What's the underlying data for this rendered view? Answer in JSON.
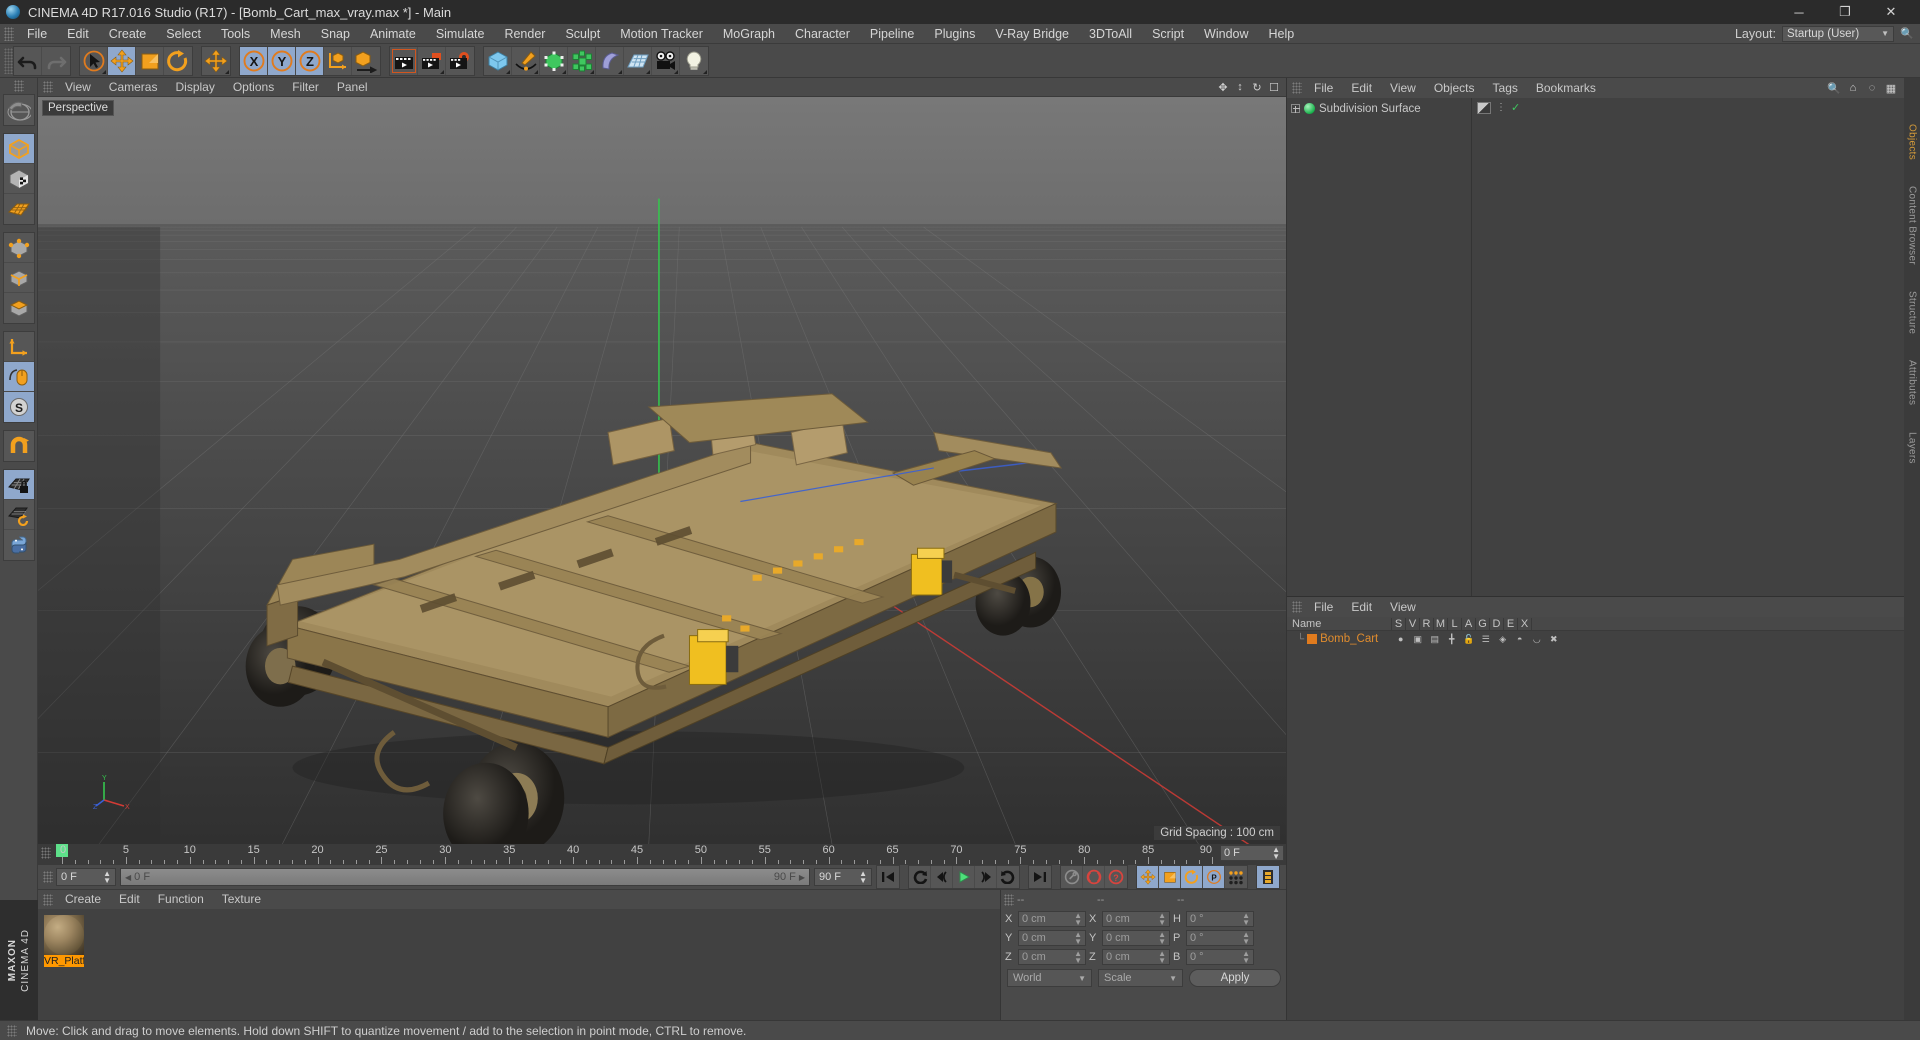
{
  "window": {
    "title": "CINEMA 4D R17.016 Studio (R17) - [Bomb_Cart_max_vray.max *] - Main",
    "minimize": "─",
    "maximize": "❐",
    "close": "✕"
  },
  "menubar": {
    "items": [
      "File",
      "Edit",
      "Create",
      "Select",
      "Tools",
      "Mesh",
      "Snap",
      "Animate",
      "Simulate",
      "Render",
      "Sculpt",
      "Motion Tracker",
      "MoGraph",
      "Character",
      "Pipeline",
      "Plugins",
      "V-Ray Bridge",
      "3DToAll",
      "Script",
      "Window",
      "Help"
    ],
    "layout_label": "Layout:",
    "layout_value": "Startup (User)",
    "search_icon": "search-icon"
  },
  "toolbar": {
    "groups": [
      {
        "name": "history",
        "buttons": [
          {
            "name": "undo-button",
            "icon": "undo-arrow-icon",
            "active": false
          },
          {
            "name": "redo-button",
            "icon": "redo-arrow-icon",
            "active": false
          }
        ]
      },
      {
        "name": "tools",
        "buttons": [
          {
            "name": "live-selection-tool",
            "icon": "cursor-circle-icon",
            "active": false
          },
          {
            "name": "move-tool",
            "icon": "move-arrows-icon",
            "active": true
          },
          {
            "name": "scale-tool",
            "icon": "scale-box-icon",
            "active": false
          },
          {
            "name": "rotate-tool",
            "icon": "rotate-ring-icon",
            "active": false
          }
        ]
      },
      {
        "name": "move-duplicate",
        "buttons": [
          {
            "name": "move-tool-alt",
            "icon": "move-arrows-icon",
            "active": false
          }
        ]
      },
      {
        "name": "axis-locks",
        "buttons": [
          {
            "name": "lock-x-axis",
            "icon": "x-axis-icon",
            "label": "X",
            "active": true
          },
          {
            "name": "lock-y-axis",
            "icon": "y-axis-icon",
            "label": "Y",
            "active": true
          },
          {
            "name": "lock-z-axis",
            "icon": "z-axis-icon",
            "label": "Z",
            "active": true
          },
          {
            "name": "world-object-coordinates",
            "icon": "axis-cube-icon",
            "active": false
          }
        ]
      },
      {
        "name": "render",
        "buttons": [
          {
            "name": "render-view-button",
            "icon": "clapper-frame-icon",
            "active": false
          },
          {
            "name": "render-to-picture-viewer-button",
            "icon": "clapper-picture-icon",
            "active": false
          },
          {
            "name": "render-settings-button",
            "icon": "clapper-gear-icon",
            "active": false
          }
        ]
      },
      {
        "name": "create",
        "buttons": [
          {
            "name": "add-cube-button",
            "icon": "blue-cube-icon",
            "active": false
          },
          {
            "name": "add-spline-button",
            "icon": "pen-spline-icon",
            "active": false
          },
          {
            "name": "add-generator-button",
            "icon": "green-cube-generator-icon",
            "active": false
          },
          {
            "name": "add-mograph-button",
            "icon": "green-cluster-icon",
            "active": false
          },
          {
            "name": "add-deformer-button",
            "icon": "bend-deformer-icon",
            "active": false
          },
          {
            "name": "add-scene-object-button",
            "icon": "floor-grid-icon",
            "active": false
          },
          {
            "name": "add-camera-button",
            "icon": "camera-icon",
            "active": false
          },
          {
            "name": "add-light-button",
            "icon": "lightbulb-icon",
            "active": false
          }
        ]
      }
    ]
  },
  "leftbar": {
    "groups": [
      {
        "buttons": [
          {
            "name": "undo-view-button",
            "icon": "globe-helmet-icon",
            "active": false
          }
        ]
      },
      {
        "buttons": [
          {
            "name": "make-editable-button",
            "icon": "editable-cube-icon",
            "active": true
          },
          {
            "name": "model-mode-button",
            "icon": "checker-cube-icon",
            "active": false
          },
          {
            "name": "texture-mode-button",
            "icon": "texture-grid-icon",
            "active": false
          }
        ]
      },
      {
        "buttons": [
          {
            "name": "points-mode-button",
            "icon": "points-cube-icon",
            "active": false
          },
          {
            "name": "edges-mode-button",
            "icon": "edges-cube-icon",
            "active": false
          },
          {
            "name": "polygons-mode-button",
            "icon": "polygons-cube-icon",
            "active": false
          }
        ]
      },
      {
        "buttons": [
          {
            "name": "object-axis-button",
            "icon": "axis-corner-icon",
            "active": false
          },
          {
            "name": "enable-axis-modification-button",
            "icon": "mouse-axis-icon",
            "active": true
          },
          {
            "name": "soft-selection-button",
            "icon": "s-sphere-icon",
            "active": true
          }
        ]
      },
      {
        "buttons": [
          {
            "name": "magnet-tool-button",
            "icon": "magnet-icon",
            "active": false
          }
        ]
      },
      {
        "buttons": [
          {
            "name": "workplane-lock-button",
            "icon": "grid-lock-icon",
            "active": true
          },
          {
            "name": "workplane-rotate-button",
            "icon": "grid-rotate-icon",
            "active": false
          },
          {
            "name": "python-script-button",
            "icon": "python-icon",
            "active": false
          }
        ]
      }
    ],
    "brand_line1": "MAXON",
    "brand_line2": "CINEMA 4D"
  },
  "viewport": {
    "menu": [
      "View",
      "Cameras",
      "Display",
      "Options",
      "Filter",
      "Panel"
    ],
    "label": "Perspective",
    "grid_spacing": "Grid Spacing : 100 cm",
    "axis_labels": {
      "y": "Y",
      "x": "X",
      "z": "Z"
    },
    "nav_icons": [
      "move-view-icon",
      "zoom-view-icon",
      "rotate-view-icon",
      "maximize-view-icon"
    ]
  },
  "timeline": {
    "ticks": [
      0,
      5,
      10,
      15,
      20,
      25,
      30,
      35,
      40,
      45,
      50,
      55,
      60,
      65,
      70,
      75,
      80,
      85,
      90
    ],
    "min": 0,
    "max": 90,
    "current_frame_field": "0 F",
    "playhead_frame": 0
  },
  "animbar": {
    "current_frame": "0 F",
    "range_start": "0 F",
    "range_end": "90 F",
    "preview_end": "90 F",
    "buttons": [
      {
        "name": "go-to-start-button",
        "icon": "skip-start-icon"
      },
      {
        "name": "go-to-previous-key-button",
        "icon": "prev-key-icon"
      },
      {
        "name": "go-to-previous-frame-button",
        "icon": "step-back-icon"
      },
      {
        "name": "play-button",
        "icon": "play-icon"
      },
      {
        "name": "go-to-next-frame-button",
        "icon": "step-forward-icon"
      },
      {
        "name": "go-to-next-key-button",
        "icon": "next-key-icon"
      },
      {
        "name": "go-to-end-button",
        "icon": "skip-end-icon"
      },
      {
        "name": "record-active-objects-button",
        "icon": "key-record-icon"
      },
      {
        "name": "autokeying-button",
        "icon": "autokey-circle-icon"
      },
      {
        "name": "keyframe-selection-button",
        "icon": "question-circle-icon"
      },
      {
        "name": "position-key-button",
        "icon": "move-arrows-icon"
      },
      {
        "name": "scale-key-button",
        "icon": "scale-box-icon"
      },
      {
        "name": "rotation-key-button",
        "icon": "rotate-ring-icon"
      },
      {
        "name": "parameter-key-button",
        "icon": "p-circle-icon"
      },
      {
        "name": "point-level-animation-button",
        "icon": "dots-grid-icon"
      },
      {
        "name": "timeline-toggle-button",
        "icon": "filmstrip-icon"
      }
    ]
  },
  "material_manager": {
    "menu": [
      "Create",
      "Edit",
      "Function",
      "Texture"
    ],
    "materials": [
      {
        "name": "VR_Platf",
        "preview": "brown-sphere-preview"
      }
    ]
  },
  "coordinates": {
    "headers": [
      "--",
      "--",
      "--"
    ],
    "rows": [
      {
        "label_a": "X",
        "value_a": "0 cm",
        "label_b": "X",
        "value_b": "0 cm",
        "label_c": "H",
        "value_c": "0 °"
      },
      {
        "label_a": "Y",
        "value_a": "0 cm",
        "label_b": "Y",
        "value_b": "0 cm",
        "label_c": "P",
        "value_c": "0 °"
      },
      {
        "label_a": "Z",
        "value_a": "0 cm",
        "label_b": "Z",
        "value_b": "0 cm",
        "label_c": "B",
        "value_c": "0 °"
      }
    ],
    "system": "World",
    "mode": "Scale",
    "apply": "Apply"
  },
  "object_manager": {
    "menu": [
      "File",
      "Edit",
      "View",
      "Objects",
      "Tags",
      "Bookmarks"
    ],
    "icons": [
      "search-icon",
      "home-icon",
      "eye-icon",
      "panel-icon"
    ],
    "objects": [
      {
        "name": "Subdivision Surface",
        "tag": "subdivision-tag",
        "check": "✓"
      }
    ]
  },
  "layer_manager": {
    "menu": [
      "File",
      "Edit",
      "View"
    ],
    "columns": [
      "Name",
      "S",
      "V",
      "R",
      "M",
      "L",
      "A",
      "G",
      "D",
      "E",
      "X"
    ],
    "rows": [
      {
        "name": "Bomb_Cart"
      }
    ]
  },
  "edge_tabs": [
    "Objects",
    "Content Browser",
    "Structure",
    "Attributes",
    "Layers"
  ],
  "statusbar": {
    "message": "Move: Click and drag to move elements. Hold down SHIFT to quantize movement / add to the selection in point mode, CTRL to remove."
  },
  "colors": {
    "accent_orange": "#f2a01e",
    "active_blue": "#8fa8cc",
    "panel_bg": "#4a4a4a",
    "viewport_sky": "#6e6e6e",
    "playhead_green": "#5ee08a",
    "layer_orange": "#e08c2e"
  }
}
